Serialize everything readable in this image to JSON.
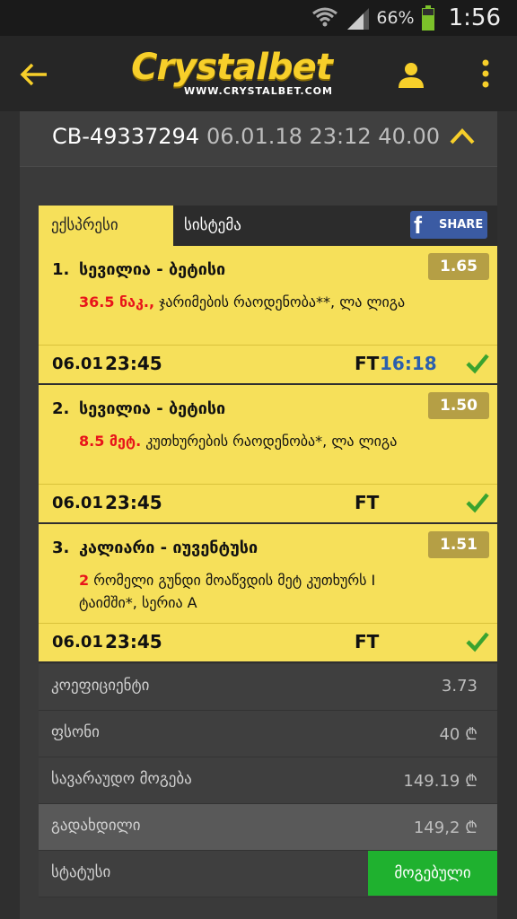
{
  "status_bar": {
    "battery": "66%",
    "time": "1:56"
  },
  "app_bar": {
    "logo": "Crystalbet",
    "logo_sub": "WWW.CRYSTALBET.COM"
  },
  "ticket": {
    "id": "CB-49337294",
    "meta": "06.01.18 23:12 40.00"
  },
  "tabs": {
    "express": "ექსპრესი",
    "system": "სისტემა",
    "share": "SHARE"
  },
  "bets": [
    {
      "num": "1.",
      "title": "სევილია - ბეტისი",
      "desc_highlight": "36.5 ნაკ.,",
      "desc_rest": " ჯარიმების რაოდენობა**, ლა ლიგა",
      "odds": "1.65",
      "date": "06.01",
      "time": "23:45",
      "ft": "FT",
      "ft_time": "16:18"
    },
    {
      "num": "2.",
      "title": "სევილია - ბეტისი",
      "desc_highlight": "8.5 მეტ.",
      "desc_rest": " კუთხურების რაოდენობა*, ლა ლიგა",
      "odds": "1.50",
      "date": "06.01",
      "time": "23:45",
      "ft": "FT",
      "ft_time": ""
    },
    {
      "num": "3.",
      "title": "კალიარი - იუვენტუსი",
      "desc_highlight": "2",
      "desc_rest": " რომელი გუნდი მოაწვდის მეტ კუთხურს I ტაიმში*, სერია A",
      "odds": "1.51",
      "date": "06.01",
      "time": "23:45",
      "ft": "FT",
      "ft_time": ""
    }
  ],
  "summary": {
    "coef_label": "კოეფიციენტი",
    "coef_value": "3.73",
    "stake_label": "ფსონი",
    "stake_value": "40 ₾",
    "potential_label": "სავარაუდო მოგება",
    "potential_value": "149.19 ₾",
    "paid_label": "გადახდილი",
    "paid_value": "149,2 ₾",
    "status_label": "სტატუსი",
    "status_value": "მოგებული"
  },
  "colors": {
    "accent": "#f6e05a",
    "odds_bg": "#b59f45",
    "win": "#1fb12f",
    "highlight": "#e8141a"
  }
}
